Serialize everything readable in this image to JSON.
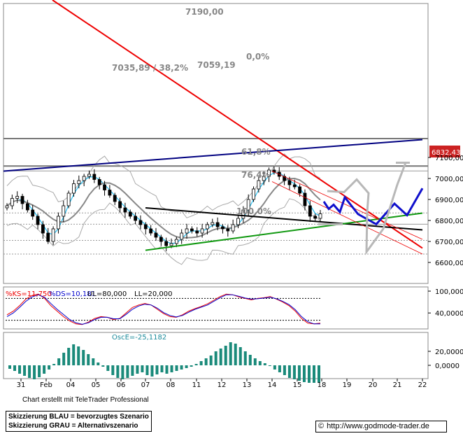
{
  "chart_data": [
    {
      "type": "candlestick",
      "title": "",
      "x_tick_labels": [
        "31",
        "Feb",
        "04",
        "05",
        "06",
        "07",
        "08",
        "11",
        "12",
        "13",
        "14",
        "15",
        "18",
        "19",
        "20",
        "21",
        "22"
      ],
      "y_tick_labels": [
        "7100,00",
        "7000,00",
        "6900,00",
        "6800,00",
        "6700,00",
        "6600,00"
      ],
      "ylim": [
        6540,
        7200
      ],
      "last_price_label": "6832,43",
      "annotations": [
        "7190,00",
        "7035,89 / 38,2%",
        "7059,19",
        "0,0%",
        "61,8%",
        "76,4%",
        "100,0%"
      ],
      "horizontal_levels": [
        7190,
        7059.19,
        7035.89,
        6836,
        6782,
        6705,
        6640
      ],
      "trendlines": {
        "red": {
          "from": [
            "31",
            7250
          ],
          "to": [
            "22",
            6668
          ]
        },
        "navy": {
          "from": [
            "31",
            7035
          ],
          "to": [
            "22",
            7185
          ]
        },
        "black": {
          "from": [
            "07",
            6860
          ],
          "to": [
            "22",
            6755
          ]
        },
        "green": {
          "from": [
            "07",
            6658
          ],
          "to": [
            "22",
            6835
          ]
        }
      },
      "scenario_blue": [
        6890,
        6855,
        6875,
        6840,
        6910,
        6830,
        6782,
        6880,
        6825,
        6953
      ],
      "scenario_gray": [
        6940,
        6935,
        6995,
        6930,
        6840,
        6650,
        6760,
        6970,
        7075
      ]
    },
    {
      "type": "line",
      "title": "",
      "header": [
        "%KS=11,750",
        "%DS=10,181",
        "UL=80,000",
        "LL=20,000"
      ],
      "y_tick_labels": [
        "100,0000",
        "40,0000"
      ],
      "ylim": [
        0,
        115
      ],
      "reference_lines": [
        80,
        20
      ],
      "series": [
        {
          "name": "%KS",
          "color": "#ee0000",
          "values": [
            35,
            45,
            60,
            78,
            88,
            92,
            80,
            60,
            45,
            30,
            18,
            10,
            8,
            15,
            25,
            30,
            28,
            22,
            25,
            40,
            55,
            62,
            66,
            62,
            50,
            38,
            30,
            28,
            35,
            45,
            52,
            58,
            65,
            75,
            85,
            92,
            90,
            84,
            80,
            76,
            80,
            82,
            85,
            78,
            70,
            60,
            45,
            25,
            12,
            10,
            12
          ]
        },
        {
          "name": "%DS",
          "color": "#0000cc",
          "values": [
            30,
            40,
            55,
            72,
            84,
            90,
            83,
            66,
            50,
            36,
            22,
            13,
            9,
            13,
            22,
            28,
            28,
            24,
            24,
            36,
            50,
            59,
            64,
            62,
            53,
            41,
            33,
            29,
            33,
            42,
            50,
            56,
            62,
            72,
            82,
            90,
            90,
            86,
            81,
            78,
            79,
            81,
            83,
            79,
            72,
            63,
            49,
            30,
            16,
            10,
            10
          ]
        }
      ]
    },
    {
      "type": "bar",
      "title": "",
      "header": [
        "OscE=-25,1182"
      ],
      "y_tick_labels": [
        "20,0000",
        "0,0000"
      ],
      "ylim": [
        -35,
        35
      ],
      "values": [
        -5,
        -8,
        -12,
        -15,
        -18,
        -20,
        -17,
        -12,
        -6,
        2,
        10,
        18,
        25,
        30,
        27,
        22,
        16,
        10,
        4,
        -2,
        -8,
        -14,
        -18,
        -20,
        -18,
        -15,
        -12,
        -10,
        -14,
        -16,
        -13,
        -10,
        -12,
        -10,
        -8,
        -6,
        -4,
        -2,
        2,
        6,
        10,
        14,
        20,
        24,
        28,
        33,
        31,
        26,
        20,
        15,
        10,
        6,
        3,
        -1,
        -6,
        -10,
        -14,
        -18,
        -20,
        -22,
        -24,
        -25,
        -25,
        -25
      ]
    }
  ],
  "footer": {
    "credit": "Chart erstellt mit TeleTrader Professional",
    "legend": [
      "Skizzierung BLAU = bevorzugtes Szenario",
      "Skizzierung GRAU = Alternativszenario"
    ],
    "url": "http://www.godmode-trader.de",
    "copyright_symbol": "©"
  },
  "colors": {
    "red_trend": "#ee0000",
    "navy_trend": "#000080",
    "green_trend": "#119911",
    "blue_scenario": "#1010cc",
    "gray_scenario": "#b8b8b8",
    "candles": "#000000",
    "fast_ma": "#22bbee",
    "slow_ma": "#888888",
    "bands": "#aaaaaa",
    "price_tag": "#cc2222",
    "osc_bars": "#1a8a7a"
  }
}
